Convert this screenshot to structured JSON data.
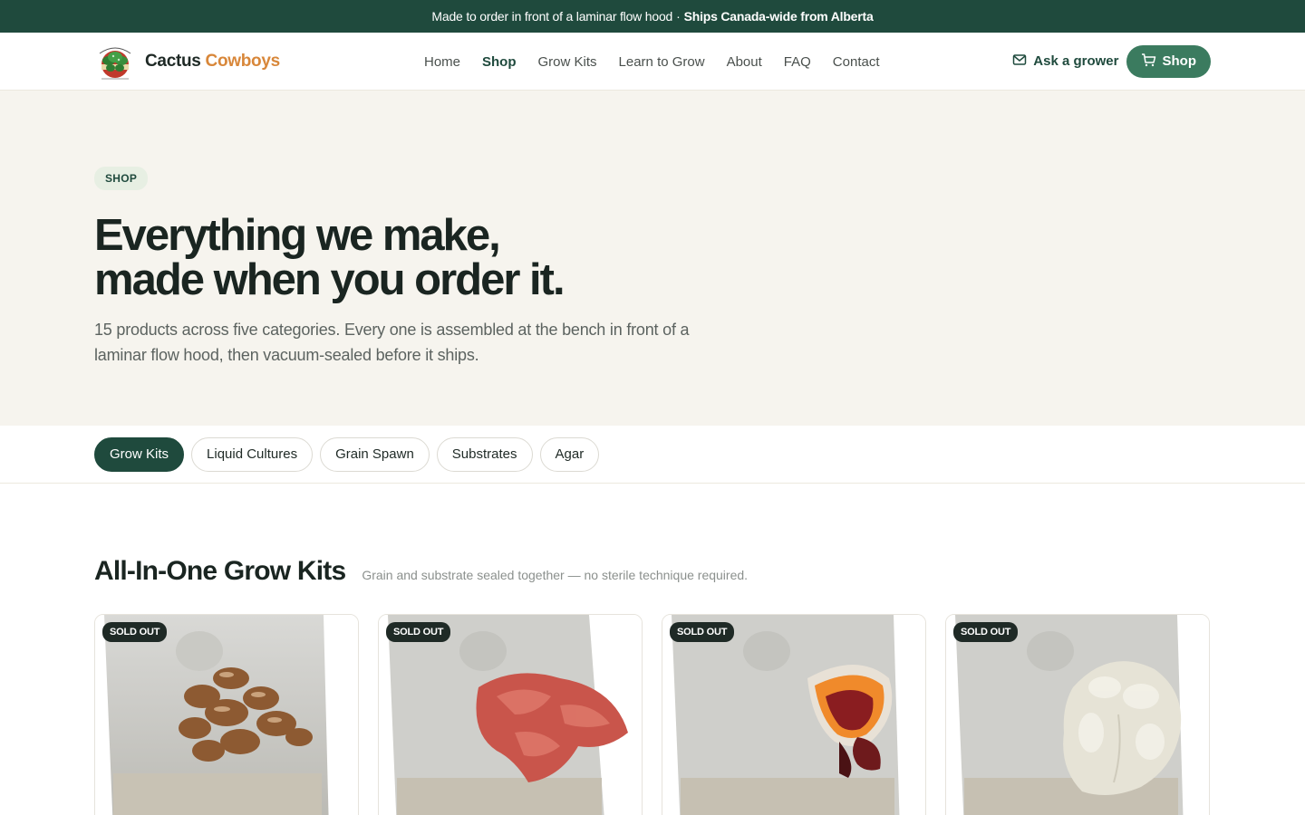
{
  "announcement": {
    "text": "Made to order in front of a laminar flow hood",
    "separator": "·",
    "bold": "Ships Canada-wide from Alberta"
  },
  "brand": {
    "name_part1": "Cactus",
    "name_part2": "Cowboys",
    "logo_icon": "mushroom-logo-icon",
    "accent_color": "#d8873a"
  },
  "nav": {
    "links": [
      "Home",
      "Shop",
      "Grow Kits",
      "Learn to Grow",
      "About",
      "FAQ",
      "Contact"
    ],
    "ask_label": "Ask a grower",
    "shop_label": "Shop"
  },
  "hero": {
    "eyebrow": "SHOP",
    "title_line1": "Everything we make,",
    "title_line2": "made when you order it.",
    "subtitle": "15 products across five categories. Every one is assembled at the bench in front of a laminar flow hood, then vacuum-sealed before it ships."
  },
  "categories": {
    "items": [
      "Grow Kits",
      "Liquid Cultures",
      "Grain Spawn",
      "Substrates",
      "Agar"
    ],
    "active": "Grow Kits"
  },
  "section": {
    "title": "All-In-One Grow Kits",
    "subtitle": "Grain and substrate sealed together — no sterile technique required."
  },
  "products": [
    {
      "badge": "SOLD OUT",
      "image": "brown-mushroom-cluster-kit"
    },
    {
      "badge": "SOLD OUT",
      "image": "pink-oyster-mushroom-kit"
    },
    {
      "badge": "SOLD OUT",
      "image": "reishi-mushroom-kit"
    },
    {
      "badge": "SOLD OUT",
      "image": "lions-mane-mushroom-kit"
    }
  ],
  "colors": {
    "primary_dark": "#1f4a3d",
    "primary": "#3b7b5f",
    "hero_bg": "#f6f4ee"
  }
}
